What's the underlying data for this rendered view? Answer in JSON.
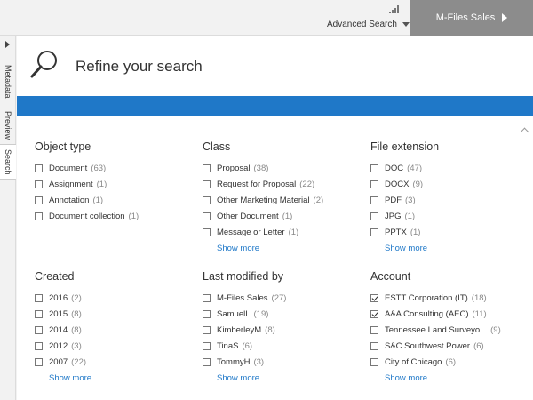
{
  "topbar": {
    "advanced_search": "Advanced Search",
    "vault_name": "M-Files Sales"
  },
  "sidetabs": [
    "Metadata",
    "Preview",
    "Search"
  ],
  "panel": {
    "title": "Refine your search",
    "accent_color": "#1f78c8"
  },
  "facets": [
    {
      "name": "Object type",
      "options": [
        {
          "label": "Document",
          "count": "(63)",
          "checked": false
        },
        {
          "label": "Assignment",
          "count": "(1)",
          "checked": false
        },
        {
          "label": "Annotation",
          "count": "(1)",
          "checked": false
        },
        {
          "label": "Document collection",
          "count": "(1)",
          "checked": false
        }
      ],
      "more": ""
    },
    {
      "name": "Class",
      "options": [
        {
          "label": "Proposal",
          "count": "(38)",
          "checked": false
        },
        {
          "label": "Request for Proposal",
          "count": "(22)",
          "checked": false
        },
        {
          "label": "Other Marketing Material",
          "count": "(2)",
          "checked": false
        },
        {
          "label": "Other Document",
          "count": "(1)",
          "checked": false
        },
        {
          "label": "Message or Letter",
          "count": "(1)",
          "checked": false
        }
      ],
      "more": "Show more"
    },
    {
      "name": "File extension",
      "options": [
        {
          "label": "DOC",
          "count": "(47)",
          "checked": false
        },
        {
          "label": "DOCX",
          "count": "(9)",
          "checked": false
        },
        {
          "label": "PDF",
          "count": "(3)",
          "checked": false
        },
        {
          "label": "JPG",
          "count": "(1)",
          "checked": false
        },
        {
          "label": "PPTX",
          "count": "(1)",
          "checked": false
        }
      ],
      "more": "Show more"
    },
    {
      "name": "Created",
      "options": [
        {
          "label": "2016",
          "count": "(2)",
          "checked": false
        },
        {
          "label": "2015",
          "count": "(8)",
          "checked": false
        },
        {
          "label": "2014",
          "count": "(8)",
          "checked": false
        },
        {
          "label": "2012",
          "count": "(3)",
          "checked": false
        },
        {
          "label": "2007",
          "count": "(22)",
          "checked": false
        }
      ],
      "more": "Show more"
    },
    {
      "name": "Last modified by",
      "options": [
        {
          "label": "M-Files Sales",
          "count": "(27)",
          "checked": false
        },
        {
          "label": "SamuelL",
          "count": "(19)",
          "checked": false
        },
        {
          "label": "KimberleyM",
          "count": "(8)",
          "checked": false
        },
        {
          "label": "TinaS",
          "count": "(6)",
          "checked": false
        },
        {
          "label": "TommyH",
          "count": "(3)",
          "checked": false
        }
      ],
      "more": "Show more"
    },
    {
      "name": "Account",
      "options": [
        {
          "label": "ESTT Corporation (IT)",
          "count": "(18)",
          "checked": true
        },
        {
          "label": "A&A Consulting (AEC)",
          "count": "(11)",
          "checked": true
        },
        {
          "label": "Tennessee Land Surveyo...",
          "count": "(9)",
          "checked": false
        },
        {
          "label": "S&C Southwest Power",
          "count": "(6)",
          "checked": false
        },
        {
          "label": "City of Chicago",
          "count": "(6)",
          "checked": false
        }
      ],
      "more": "Show more"
    }
  ]
}
